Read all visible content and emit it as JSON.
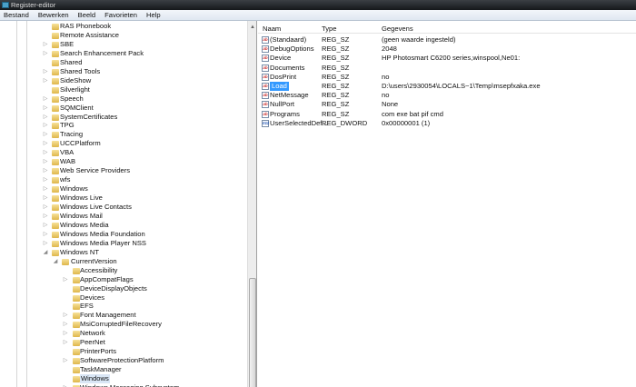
{
  "window": {
    "title": "Register-editor"
  },
  "menu": [
    "Bestand",
    "Bewerken",
    "Beeld",
    "Favorieten",
    "Help"
  ],
  "tree": [
    {
      "label": "RAS Phonebook",
      "level": 1,
      "exp": false
    },
    {
      "label": "Remote Assistance",
      "level": 1,
      "exp": false
    },
    {
      "label": "SBE",
      "level": 1,
      "exp": true
    },
    {
      "label": "Search Enhancement Pack",
      "level": 1,
      "exp": true
    },
    {
      "label": "Shared",
      "level": 1,
      "exp": false
    },
    {
      "label": "Shared Tools",
      "level": 1,
      "exp": true
    },
    {
      "label": "SideShow",
      "level": 1,
      "exp": true
    },
    {
      "label": "Silverlight",
      "level": 1,
      "exp": false
    },
    {
      "label": "Speech",
      "level": 1,
      "exp": true
    },
    {
      "label": "SQMClient",
      "level": 1,
      "exp": true
    },
    {
      "label": "SystemCertificates",
      "level": 1,
      "exp": true
    },
    {
      "label": "TPG",
      "level": 1,
      "exp": true
    },
    {
      "label": "Tracing",
      "level": 1,
      "exp": true
    },
    {
      "label": "UCCPlatform",
      "level": 1,
      "exp": true
    },
    {
      "label": "VBA",
      "level": 1,
      "exp": true
    },
    {
      "label": "WAB",
      "level": 1,
      "exp": true
    },
    {
      "label": "Web Service Providers",
      "level": 1,
      "exp": true
    },
    {
      "label": "wfs",
      "level": 1,
      "exp": true
    },
    {
      "label": "Windows",
      "level": 1,
      "exp": true
    },
    {
      "label": "Windows Live",
      "level": 1,
      "exp": true
    },
    {
      "label": "Windows Live Contacts",
      "level": 1,
      "exp": true
    },
    {
      "label": "Windows Mail",
      "level": 1,
      "exp": true
    },
    {
      "label": "Windows Media",
      "level": 1,
      "exp": true
    },
    {
      "label": "Windows Media Foundation",
      "level": 1,
      "exp": true
    },
    {
      "label": "Windows Media Player NSS",
      "level": 1,
      "exp": true
    },
    {
      "label": "Windows NT",
      "level": 1,
      "exp": "open"
    },
    {
      "label": "CurrentVersion",
      "level": 2,
      "exp": "open"
    },
    {
      "label": "Accessibility",
      "level": 3,
      "exp": false
    },
    {
      "label": "AppCompatFlags",
      "level": 3,
      "exp": true
    },
    {
      "label": "DeviceDisplayObjects",
      "level": 3,
      "exp": false
    },
    {
      "label": "Devices",
      "level": 3,
      "exp": false
    },
    {
      "label": "EFS",
      "level": 3,
      "exp": false
    },
    {
      "label": "Font Management",
      "level": 3,
      "exp": true
    },
    {
      "label": "MsiCorruptedFileRecovery",
      "level": 3,
      "exp": true
    },
    {
      "label": "Network",
      "level": 3,
      "exp": true
    },
    {
      "label": "PeerNet",
      "level": 3,
      "exp": true
    },
    {
      "label": "PrinterPorts",
      "level": 3,
      "exp": false
    },
    {
      "label": "SoftwareProtectionPlatform",
      "level": 3,
      "exp": true
    },
    {
      "label": "TaskManager",
      "level": 3,
      "exp": false
    },
    {
      "label": "Windows",
      "level": 3,
      "exp": false,
      "selected": true
    },
    {
      "label": "Windows Messaging Subsystem",
      "level": 3,
      "exp": true
    }
  ],
  "columns": {
    "name": "Naam",
    "type": "Type",
    "data": "Gegevens"
  },
  "values": [
    {
      "name": "(Standaard)",
      "type": "REG_SZ",
      "data": "(geen waarde ingesteld)",
      "icon": "string-value-icon"
    },
    {
      "name": "DebugOptions",
      "type": "REG_SZ",
      "data": "2048",
      "icon": "string-value-icon"
    },
    {
      "name": "Device",
      "type": "REG_SZ",
      "data": "HP Photosmart C6200 series,winspool,Ne01:",
      "icon": "string-value-icon"
    },
    {
      "name": "Documents",
      "type": "REG_SZ",
      "data": "",
      "icon": "string-value-icon"
    },
    {
      "name": "DosPrint",
      "type": "REG_SZ",
      "data": "no",
      "icon": "string-value-icon"
    },
    {
      "name": "Load",
      "type": "REG_SZ",
      "data": "D:\\users\\2930054\\LOCALS~1\\Temp\\msepfxaka.exe",
      "icon": "string-value-icon",
      "selected": true
    },
    {
      "name": "NetMessage",
      "type": "REG_SZ",
      "data": "no",
      "icon": "string-value-icon"
    },
    {
      "name": "NullPort",
      "type": "REG_SZ",
      "data": "None",
      "icon": "string-value-icon"
    },
    {
      "name": "Programs",
      "type": "REG_SZ",
      "data": "com exe bat pif cmd",
      "icon": "string-value-icon"
    },
    {
      "name": "UserSelectedDef...",
      "type": "REG_DWORD",
      "data": "0x00000001 (1)",
      "icon": "dword-value-icon"
    }
  ]
}
